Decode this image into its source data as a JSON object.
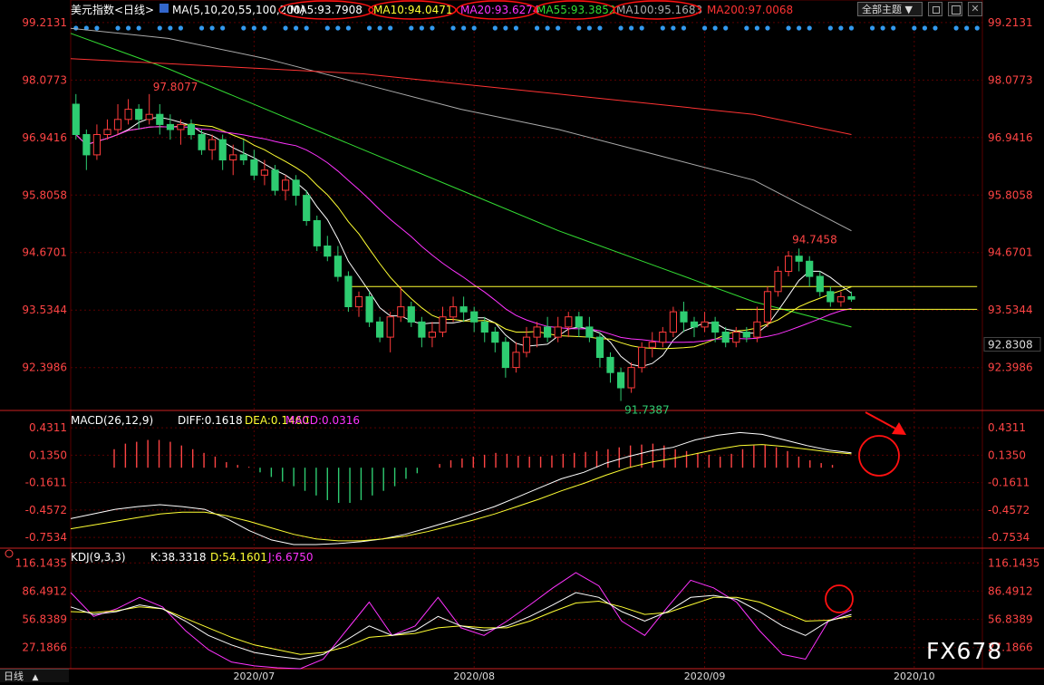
{
  "header": {
    "symbol": "美元指数<日线>",
    "ma_label": "MA(5,10,20,55,100,200)",
    "ma_items": [
      {
        "label": "MA5:93.7908",
        "color": "#ffffff"
      },
      {
        "label": "MA10:94.0471",
        "color": "#ffff33"
      },
      {
        "label": "MA20:93.6274",
        "color": "#ff33ff"
      },
      {
        "label": "MA55:93.3852",
        "color": "#33dd33"
      },
      {
        "label": "MA100:95.1683",
        "color": "#aaaaaa"
      },
      {
        "label": "MA200:97.0068",
        "color": "#ff3333"
      }
    ],
    "theme_button": "全部主题",
    "period_tab": "日线"
  },
  "watermark": "FX678",
  "colors": {
    "up": "#ff3b3b",
    "down": "#2ecc71",
    "axis": "#cc2222",
    "grid": "#5a0000"
  },
  "chart_data": {
    "type": "candlestick",
    "x_labels": [
      "2020/07",
      "2020/08",
      "2020/09",
      "2020/10"
    ],
    "x_label_index": [
      17,
      38,
      60,
      80
    ],
    "ylim": [
      91.57,
      99.3
    ],
    "y_ticks": [
      "99.2131",
      "98.0773",
      "96.9416",
      "95.8058",
      "94.6701",
      "93.5344",
      "92.3986"
    ],
    "current_price": "92.8308",
    "annotations": [
      "97.8077",
      "94.7458",
      "91.7387"
    ],
    "candles": [
      [
        97.6,
        97.0,
        97.8,
        96.9
      ],
      [
        97.0,
        96.6,
        97.1,
        96.3
      ],
      [
        96.6,
        97.0,
        97.2,
        96.5
      ],
      [
        97.0,
        97.1,
        97.3,
        96.9
      ],
      [
        97.1,
        97.3,
        97.6,
        97.0
      ],
      [
        97.3,
        97.5,
        97.7,
        97.2
      ],
      [
        97.5,
        97.3,
        97.6,
        97.1
      ],
      [
        97.3,
        97.4,
        97.8,
        97.2
      ],
      [
        97.4,
        97.2,
        97.6,
        97.0
      ],
      [
        97.2,
        97.1,
        97.4,
        96.9
      ],
      [
        97.1,
        97.2,
        97.3,
        96.8
      ],
      [
        97.2,
        97.0,
        97.3,
        96.9
      ],
      [
        97.0,
        96.7,
        97.1,
        96.6
      ],
      [
        96.7,
        96.9,
        97.0,
        96.5
      ],
      [
        96.9,
        96.5,
        97.0,
        96.3
      ],
      [
        96.5,
        96.6,
        96.8,
        96.2
      ],
      [
        96.6,
        96.5,
        96.9,
        96.4
      ],
      [
        96.5,
        96.2,
        96.7,
        96.1
      ],
      [
        96.2,
        96.3,
        96.5,
        96.0
      ],
      [
        96.3,
        95.9,
        96.4,
        95.8
      ],
      [
        95.9,
        96.1,
        96.2,
        95.7
      ],
      [
        96.1,
        95.8,
        96.2,
        95.6
      ],
      [
        95.8,
        95.3,
        95.9,
        95.2
      ],
      [
        95.3,
        94.8,
        95.4,
        94.7
      ],
      [
        94.8,
        94.6,
        95.0,
        94.5
      ],
      [
        94.6,
        94.2,
        94.8,
        94.1
      ],
      [
        94.2,
        93.6,
        94.3,
        93.5
      ],
      [
        93.6,
        93.8,
        93.9,
        93.4
      ],
      [
        93.8,
        93.3,
        93.9,
        93.2
      ],
      [
        93.3,
        93.0,
        93.4,
        92.9
      ],
      [
        93.0,
        93.4,
        93.5,
        92.7
      ],
      [
        93.4,
        93.6,
        94.0,
        93.3
      ],
      [
        93.6,
        93.3,
        93.7,
        93.2
      ],
      [
        93.3,
        93.0,
        93.4,
        92.8
      ],
      [
        93.0,
        93.1,
        93.3,
        92.8
      ],
      [
        93.1,
        93.4,
        93.6,
        93.0
      ],
      [
        93.4,
        93.6,
        93.8,
        93.3
      ],
      [
        93.6,
        93.5,
        93.8,
        93.3
      ],
      [
        93.5,
        93.3,
        93.6,
        93.1
      ],
      [
        93.3,
        93.1,
        93.4,
        92.9
      ],
      [
        93.1,
        92.9,
        93.2,
        92.7
      ],
      [
        92.9,
        92.4,
        93.0,
        92.2
      ],
      [
        92.4,
        92.7,
        92.9,
        92.3
      ],
      [
        92.7,
        93.0,
        93.2,
        92.6
      ],
      [
        93.0,
        93.2,
        93.3,
        92.8
      ],
      [
        93.2,
        93.0,
        93.4,
        92.9
      ],
      [
        93.0,
        93.2,
        93.4,
        92.9
      ],
      [
        93.2,
        93.4,
        93.5,
        93.0
      ],
      [
        93.4,
        93.2,
        93.5,
        93.0
      ],
      [
        93.2,
        93.0,
        93.4,
        92.9
      ],
      [
        93.0,
        92.6,
        93.1,
        92.4
      ],
      [
        92.6,
        92.3,
        92.7,
        92.1
      ],
      [
        92.3,
        92.0,
        92.4,
        91.74
      ],
      [
        92.0,
        92.4,
        92.5,
        91.9
      ],
      [
        92.4,
        92.8,
        92.9,
        92.3
      ],
      [
        92.8,
        92.9,
        93.1,
        92.6
      ],
      [
        92.9,
        93.1,
        93.2,
        92.8
      ],
      [
        93.1,
        93.5,
        93.6,
        93.0
      ],
      [
        93.5,
        93.3,
        93.7,
        93.1
      ],
      [
        93.3,
        93.2,
        93.4,
        93.0
      ],
      [
        93.2,
        93.3,
        93.5,
        93.1
      ],
      [
        93.3,
        93.1,
        93.4,
        92.9
      ],
      [
        93.1,
        92.9,
        93.2,
        92.8
      ],
      [
        92.9,
        93.1,
        93.2,
        92.8
      ],
      [
        93.1,
        93.0,
        93.2,
        92.9
      ],
      [
        93.0,
        93.3,
        93.6,
        92.9
      ],
      [
        93.3,
        93.9,
        94.0,
        93.2
      ],
      [
        93.9,
        94.3,
        94.4,
        93.8
      ],
      [
        94.3,
        94.6,
        94.7,
        94.2
      ],
      [
        94.6,
        94.5,
        94.75,
        94.3
      ],
      [
        94.5,
        94.2,
        94.6,
        94.0
      ],
      [
        94.2,
        93.9,
        94.3,
        93.8
      ],
      [
        93.9,
        93.7,
        94.0,
        93.6
      ],
      [
        93.7,
        93.8,
        93.9,
        93.6
      ],
      [
        93.8,
        93.75,
        93.9,
        93.7
      ]
    ],
    "ma_lines": [
      {
        "name": "MA5",
        "period": 5,
        "color": "#ffffff"
      },
      {
        "name": "MA10",
        "period": 10,
        "color": "#ffff33"
      },
      {
        "name": "MA20",
        "period": 20,
        "color": "#ff33ff"
      },
      {
        "name": "MA55",
        "color": "#33dd33",
        "values": [
          99.0,
          98.3,
          97.5,
          96.7,
          95.9,
          95.1,
          94.4,
          93.7,
          93.2
        ]
      },
      {
        "name": "MA100",
        "color": "#aaaaaa",
        "values": [
          99.1,
          98.9,
          98.5,
          98.0,
          97.5,
          97.1,
          96.6,
          96.1,
          95.1
        ]
      },
      {
        "name": "MA200",
        "color": "#ff3333",
        "values": [
          98.5,
          98.4,
          98.3,
          98.2,
          98.0,
          97.8,
          97.6,
          97.4,
          97.0
        ]
      }
    ],
    "support_lines": [
      {
        "from_index": 26,
        "to_index": 86,
        "value": 94.0
      },
      {
        "from_index": 63,
        "to_index": 86,
        "value": 93.55
      }
    ],
    "macd": {
      "label": "MACD(26,12,9)",
      "items": [
        {
          "label": "DIFF:0.1618",
          "color": "#ffffff"
        },
        {
          "label": "DEA:0.1460",
          "color": "#ffff33"
        },
        {
          "label": "MACD:0.0316",
          "color": "#ff33ff"
        }
      ],
      "ylim": [
        -0.85,
        0.55
      ],
      "y_ticks": [
        "0.4311",
        "0.1350",
        "-0.1611",
        "-0.4572",
        "-0.7534"
      ],
      "diff": [
        -0.55,
        -0.5,
        -0.45,
        -0.42,
        -0.4,
        -0.42,
        -0.45,
        -0.55,
        -0.68,
        -0.78,
        -0.83,
        -0.83,
        -0.82,
        -0.8,
        -0.77,
        -0.72,
        -0.65,
        -0.58,
        -0.5,
        -0.42,
        -0.32,
        -0.22,
        -0.12,
        -0.05,
        0.05,
        0.12,
        0.18,
        0.22,
        0.3,
        0.35,
        0.38,
        0.36,
        0.3,
        0.24,
        0.19,
        0.16
      ],
      "dea": [
        -0.66,
        -0.62,
        -0.58,
        -0.54,
        -0.5,
        -0.48,
        -0.48,
        -0.52,
        -0.58,
        -0.65,
        -0.72,
        -0.77,
        -0.79,
        -0.79,
        -0.77,
        -0.74,
        -0.69,
        -0.63,
        -0.57,
        -0.5,
        -0.42,
        -0.34,
        -0.25,
        -0.17,
        -0.08,
        0.0,
        0.06,
        0.1,
        0.15,
        0.2,
        0.24,
        0.25,
        0.23,
        0.2,
        0.17,
        0.15
      ],
      "bars": [
        0.2,
        0.26,
        0.28,
        0.3,
        0.3,
        0.28,
        0.24,
        0.2,
        0.16,
        0.12,
        0.06,
        0.03,
        0.01,
        -0.05,
        -0.1,
        -0.15,
        -0.2,
        -0.25,
        -0.3,
        -0.35,
        -0.38,
        -0.38,
        -0.35,
        -0.3,
        -0.25,
        -0.2,
        -0.12,
        -0.06,
        0.0,
        0.04,
        0.08,
        0.1,
        0.12,
        0.14,
        0.16,
        0.15,
        0.13,
        0.12,
        0.12,
        0.13,
        0.15,
        0.16,
        0.17,
        0.18,
        0.2,
        0.22,
        0.24,
        0.25,
        0.26,
        0.24,
        0.2,
        0.18,
        0.16,
        0.14,
        0.12,
        0.15,
        0.2,
        0.24,
        0.25,
        0.22,
        0.18,
        0.12,
        0.08,
        0.05,
        0.03
      ]
    },
    "kdj": {
      "label": "KDJ(9,3,3)",
      "items": [
        {
          "label": "K:38.3318",
          "color": "#ffffff"
        },
        {
          "label": "D:54.1601",
          "color": "#ffff33"
        },
        {
          "label": "J:6.6750",
          "color": "#ff33ff"
        }
      ],
      "ylim": [
        5,
        125
      ],
      "y_ticks": [
        "116.1435",
        "86.4912",
        "56.8389",
        "27.1866"
      ],
      "k": [
        70,
        62,
        65,
        72,
        68,
        55,
        40,
        30,
        22,
        18,
        15,
        20,
        35,
        50,
        40,
        45,
        60,
        50,
        45,
        50,
        60,
        72,
        85,
        80,
        65,
        55,
        65,
        80,
        82,
        78,
        65,
        50,
        40,
        55,
        62
      ],
      "d": [
        65,
        64,
        66,
        70,
        68,
        58,
        48,
        38,
        30,
        25,
        20,
        22,
        28,
        38,
        40,
        42,
        48,
        50,
        48,
        48,
        55,
        65,
        74,
        76,
        70,
        62,
        64,
        72,
        80,
        80,
        75,
        65,
        55,
        56,
        60
      ],
      "j": [
        85,
        60,
        68,
        80,
        70,
        45,
        25,
        12,
        8,
        6,
        5,
        15,
        45,
        75,
        40,
        50,
        80,
        48,
        40,
        55,
        72,
        90,
        106,
        92,
        55,
        40,
        70,
        98,
        90,
        75,
        45,
        20,
        15,
        55,
        67
      ]
    }
  }
}
